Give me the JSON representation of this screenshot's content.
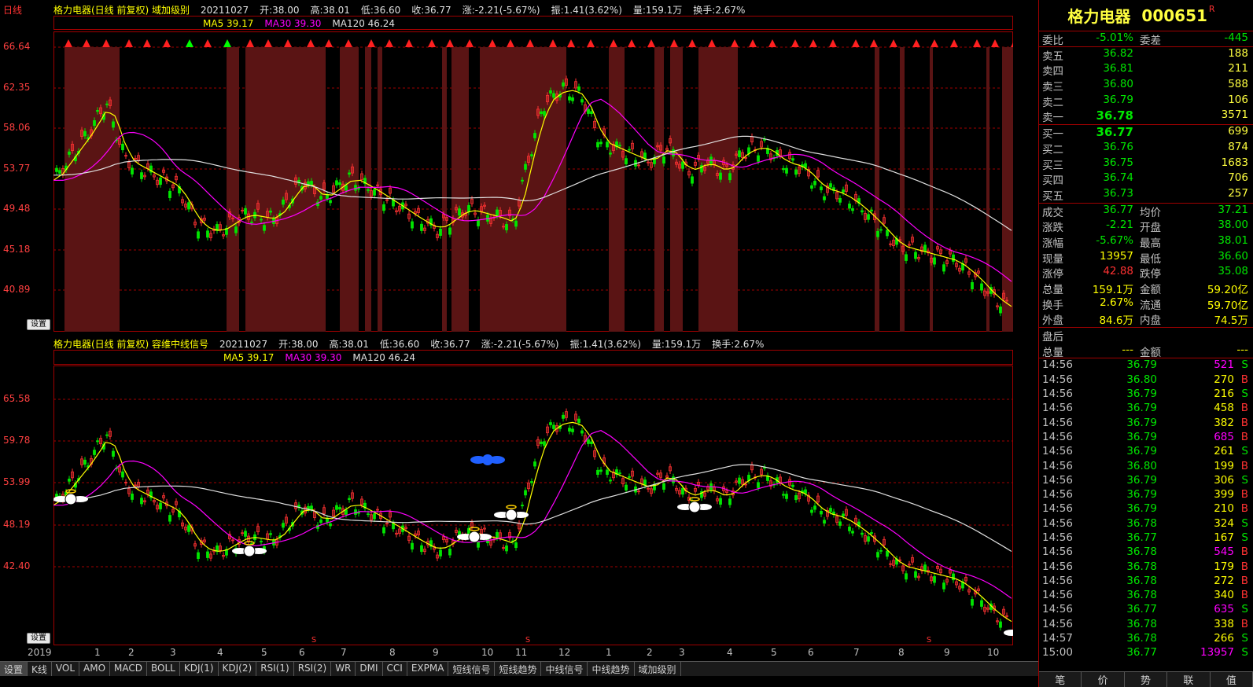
{
  "period_label": "日线",
  "panel1": {
    "info": [
      "格力电器(日线 前复权) 域加级别",
      "20211027",
      "开:38.00",
      "高:38.01",
      "低:36.60",
      "收:36.77",
      "涨:-2.21(-5.67%)",
      "振:1.41(3.62%)",
      "量:159.1万",
      "换手:2.67%"
    ],
    "ma": [
      "MA5 39.17",
      "MA30 39.30",
      "MA120 46.24"
    ],
    "price_levels": [
      "66.64",
      "62.35",
      "58.06",
      "53.77",
      "49.48",
      "45.18",
      "40.89"
    ],
    "settings_label": "设置"
  },
  "panel2": {
    "info": [
      "格力电器(日线 前复权) 容维中线信号",
      "20211027",
      "开:38.00",
      "高:38.01",
      "低:36.60",
      "收:36.77",
      "涨:-2.21(-5.67%)",
      "振:1.41(3.62%)",
      "量:159.1万",
      "换手:2.67%"
    ],
    "ma": [
      "MA5 39.17",
      "MA30 39.30",
      "MA120 46.24"
    ],
    "price_levels": [
      "65.58",
      "59.78",
      "53.99",
      "48.19",
      "42.40"
    ],
    "settings_label": "设置",
    "s_marker": "S"
  },
  "date_axis": [
    "2019",
    "1",
    "2",
    "3",
    "4",
    "5",
    "6",
    "7",
    "8",
    "9",
    "10",
    "11",
    "12",
    "1",
    "2",
    "3",
    "4",
    "5",
    "6",
    "7",
    "8",
    "9",
    "10"
  ],
  "tabs": [
    "设置",
    "K线",
    "VOL",
    "AMO",
    "MACD",
    "BOLL",
    "KDJ(1)",
    "KDJ(2)",
    "RSI(1)",
    "RSI(2)",
    "WR",
    "DMI",
    "CCI",
    "EXPMA",
    "短线信号",
    "短线趋势",
    "中线信号",
    "中线趋势",
    "域加级别"
  ],
  "quote": {
    "name": "格力电器",
    "code": "000651",
    "badge": "R",
    "weibi_label": "委比",
    "weibi": "-5.01%",
    "weicha_label": "委差",
    "weicha": "-445",
    "asks": [
      {
        "label": "卖五",
        "price": "36.82",
        "vol": "188"
      },
      {
        "label": "卖四",
        "price": "36.81",
        "vol": "211"
      },
      {
        "label": "卖三",
        "price": "36.80",
        "vol": "588"
      },
      {
        "label": "卖二",
        "price": "36.79",
        "vol": "106"
      },
      {
        "label": "卖一",
        "price": "36.78",
        "vol": "3571"
      }
    ],
    "bids": [
      {
        "label": "买一",
        "price": "36.77",
        "vol": "699"
      },
      {
        "label": "买二",
        "price": "36.76",
        "vol": "874"
      },
      {
        "label": "买三",
        "price": "36.75",
        "vol": "1683"
      },
      {
        "label": "买四",
        "price": "36.74",
        "vol": "706"
      },
      {
        "label": "买五",
        "price": "36.73",
        "vol": "257"
      }
    ],
    "stats": [
      {
        "l1": "成交",
        "v1": "36.77",
        "l2": "均价",
        "v2": "37.21",
        "c1": "green",
        "c2": "green"
      },
      {
        "l1": "涨跌",
        "v1": "-2.21",
        "l2": "开盘",
        "v2": "38.00",
        "c1": "green",
        "c2": "green"
      },
      {
        "l1": "涨幅",
        "v1": "-5.67%",
        "l2": "最高",
        "v2": "38.01",
        "c1": "green",
        "c2": "green"
      },
      {
        "l1": "现量",
        "v1": "13957",
        "l2": "最低",
        "v2": "36.60",
        "c1": "yellow",
        "c2": "green"
      },
      {
        "l1": "涨停",
        "v1": "42.88",
        "l2": "跌停",
        "v2": "35.08",
        "c1": "red",
        "c2": "green"
      },
      {
        "l1": "总量",
        "v1": "159.1万",
        "l2": "金额",
        "v2": "59.20亿",
        "c1": "yellow",
        "c2": "yellow"
      },
      {
        "l1": "换手",
        "v1": "2.67%",
        "l2": "流通",
        "v2": "59.70亿",
        "c1": "yellow",
        "c2": "yellow"
      },
      {
        "l1": "外盘",
        "v1": "84.6万",
        "l2": "内盘",
        "v2": "74.5万",
        "c1": "yellow",
        "c2": "yellow"
      }
    ],
    "after_hours_label": "盘后",
    "after_hours": {
      "l1": "总量",
      "v1": "---",
      "l2": "金额",
      "v2": "---"
    },
    "ticks": [
      {
        "t": "14:56",
        "p": "36.79",
        "v": "521",
        "bs": "S",
        "vc": "magenta"
      },
      {
        "t": "14:56",
        "p": "36.80",
        "v": "270",
        "bs": "B",
        "vc": "yellow"
      },
      {
        "t": "14:56",
        "p": "36.79",
        "v": "216",
        "bs": "S",
        "vc": "yellow"
      },
      {
        "t": "14:56",
        "p": "36.79",
        "v": "458",
        "bs": "B",
        "vc": "yellow"
      },
      {
        "t": "14:56",
        "p": "36.79",
        "v": "382",
        "bs": "B",
        "vc": "yellow"
      },
      {
        "t": "14:56",
        "p": "36.79",
        "v": "685",
        "bs": "B",
        "vc": "magenta"
      },
      {
        "t": "14:56",
        "p": "36.79",
        "v": "261",
        "bs": "S",
        "vc": "yellow"
      },
      {
        "t": "14:56",
        "p": "36.80",
        "v": "199",
        "bs": "B",
        "vc": "yellow"
      },
      {
        "t": "14:56",
        "p": "36.79",
        "v": "306",
        "bs": "S",
        "vc": "yellow"
      },
      {
        "t": "14:56",
        "p": "36.79",
        "v": "399",
        "bs": "B",
        "vc": "yellow"
      },
      {
        "t": "14:56",
        "p": "36.79",
        "v": "210",
        "bs": "B",
        "vc": "yellow"
      },
      {
        "t": "14:56",
        "p": "36.78",
        "v": "324",
        "bs": "S",
        "vc": "yellow"
      },
      {
        "t": "14:56",
        "p": "36.77",
        "v": "167",
        "bs": "S",
        "vc": "yellow"
      },
      {
        "t": "14:56",
        "p": "36.78",
        "v": "545",
        "bs": "B",
        "vc": "magenta"
      },
      {
        "t": "14:56",
        "p": "36.78",
        "v": "179",
        "bs": "B",
        "vc": "yellow"
      },
      {
        "t": "14:56",
        "p": "36.78",
        "v": "272",
        "bs": "B",
        "vc": "yellow"
      },
      {
        "t": "14:56",
        "p": "36.78",
        "v": "340",
        "bs": "B",
        "vc": "yellow"
      },
      {
        "t": "14:56",
        "p": "36.77",
        "v": "635",
        "bs": "S",
        "vc": "magenta"
      },
      {
        "t": "14:56",
        "p": "36.78",
        "v": "338",
        "bs": "B",
        "vc": "yellow"
      },
      {
        "t": "14:57",
        "p": "36.78",
        "v": "266",
        "bs": "S",
        "vc": "yellow"
      },
      {
        "t": "15:00",
        "p": "36.77",
        "v": "13957",
        "bs": "S",
        "vc": "magenta"
      }
    ],
    "bottom_tabs": [
      "笔",
      "价",
      "势",
      "联",
      "值"
    ]
  }
}
